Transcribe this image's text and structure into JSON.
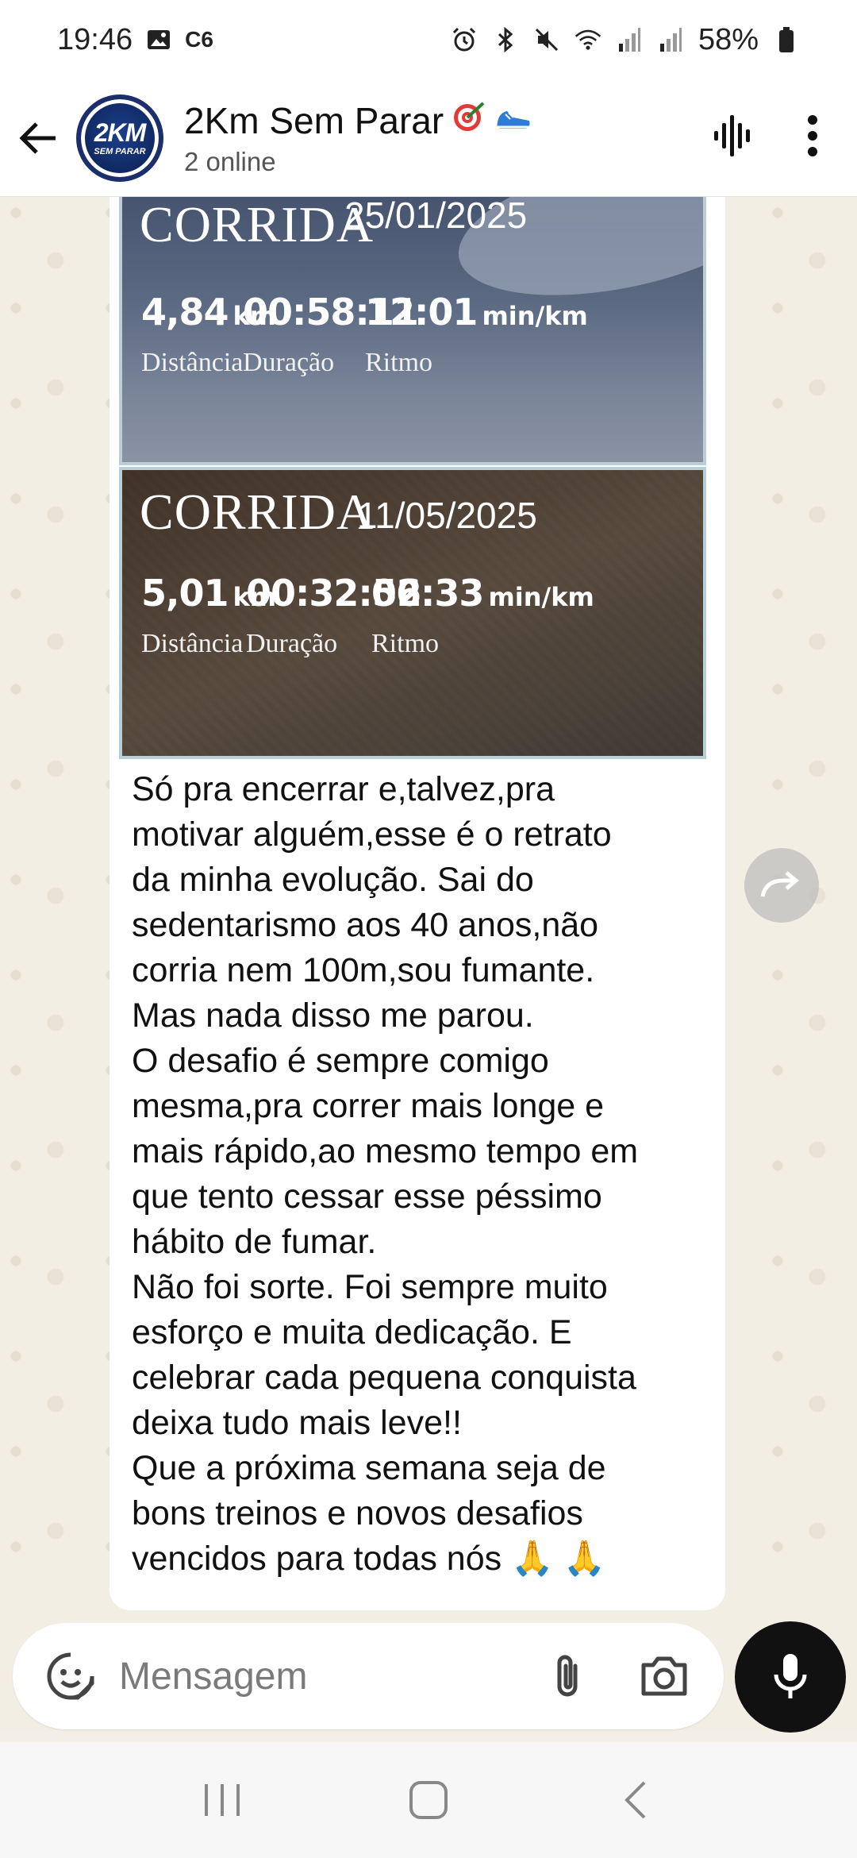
{
  "status": {
    "time": "19:46",
    "carrier_badge": "C6",
    "battery": "58%"
  },
  "header": {
    "title": "2Km Sem Parar",
    "subtitle": "2 online",
    "avatar_logo_main": "2KM",
    "avatar_logo_sub": "SEM PARAR"
  },
  "images": [
    {
      "title": "CORRIDA",
      "date": "25/01/2025",
      "distance": {
        "value": "4,84",
        "unit": "km",
        "label": "Distância"
      },
      "duration": {
        "value": "00:58:11",
        "label": "Duração"
      },
      "pace": {
        "value": "12:01",
        "unit": "min/km",
        "label": "Ritmo"
      }
    },
    {
      "title": "CORRIDA",
      "date": "11/05/2025",
      "distance": {
        "value": "5,01",
        "unit": "km",
        "label": "Distância"
      },
      "duration": {
        "value": "00:32:52",
        "label": "Duração"
      },
      "pace": {
        "value": "06:33",
        "unit": "min/km",
        "label": "Ritmo"
      }
    }
  ],
  "message": {
    "text": "Só pra encerrar e,talvez,pra\nmotivar alguém,esse é o retrato\nda minha evolução. Sai do\nsedentarismo aos 40 anos,não\ncorria nem 100m,sou fumante.\nMas nada disso me parou.\nO desafio é sempre comigo\nmesma,pra correr mais longe e\nmais rápido,ao mesmo tempo em\nque tento cessar esse péssimo\nhábito de fumar.\nNão foi sorte. Foi sempre muito\nesforço e muita dedicação. E\ncelebrar cada pequena conquista\ndeixa tudo mais leve!!\nQue a próxima semana seja de\nbons treinos e novos desafios\nvencidos para todas nós 🙏 🙏"
  },
  "composer": {
    "placeholder": "Mensagem"
  },
  "colors": {
    "chat_background": "#f3eee4",
    "bubble": "#ffffff",
    "mic_button": "#111111"
  }
}
